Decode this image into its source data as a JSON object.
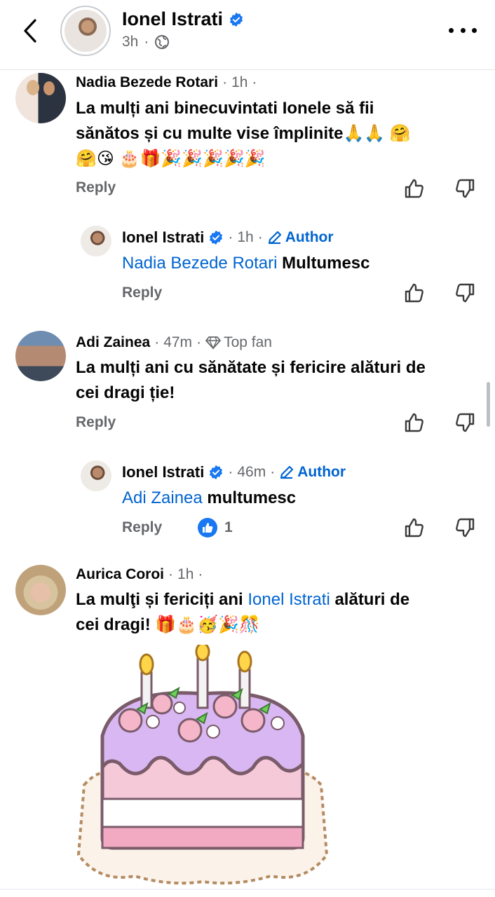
{
  "header": {
    "name": "Ionel Istrati",
    "time": "3h",
    "dot": "·"
  },
  "comments": [
    {
      "author": "Nadia Bezede Rotari",
      "time": "1h",
      "text_line1": "La mulți ani binecuvintati Ionele să fii",
      "text_line2": "sănătos și cu multe vise împlinite🙏🙏 🤗",
      "text_line3": "🤗😘 🎂🎁🎉🎉🎉🎉🎉",
      "reply_label": "Reply"
    },
    {
      "author": "Ionel Istrati",
      "time": "1h",
      "tag": "Author",
      "mention": "Nadia Bezede Rotari",
      "text": "Multumesc",
      "reply_label": "Reply"
    },
    {
      "author": "Adi Zainea",
      "time": "47m",
      "badge": "Top fan",
      "text_line1": "La mulți ani cu sănătate și fericire alături de",
      "text_line2": "cei dragi ție!",
      "reply_label": "Reply"
    },
    {
      "author": "Ionel Istrati",
      "time": "46m",
      "tag": "Author",
      "mention": "Adi Zainea",
      "text": "multumesc",
      "reply_label": "Reply",
      "like_count": "1"
    },
    {
      "author": "Aurica Coroi",
      "time": "1h",
      "text_start": "La mulţi și fericiți ani ",
      "mention": "Ionel Istrati",
      "text_end": " alături de",
      "text_line2": "cei dragi! 🎁🎂🥳🎉🎊"
    }
  ],
  "icons": {
    "back": "chevron-left-icon",
    "more": "more-horizontal-icon",
    "verified": "verified-badge-icon",
    "globe": "globe-icon",
    "like": "thumbs-up-icon",
    "dislike": "thumbs-down-icon",
    "pencil": "pencil-icon",
    "diamond": "diamond-icon"
  },
  "colors": {
    "link": "#0064d1",
    "verified": "#1877f2",
    "secondary": "#65676b"
  }
}
